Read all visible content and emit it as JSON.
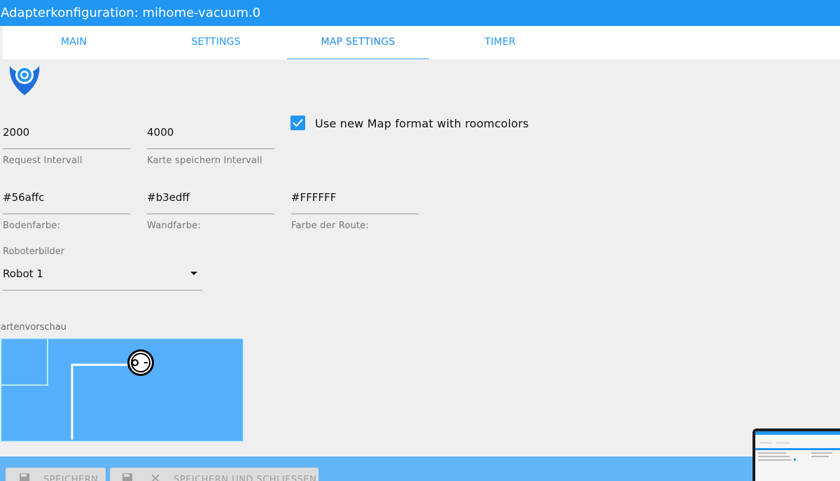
{
  "window": {
    "title": "Adapterkonfiguration: mihome-vacuum.0"
  },
  "tabs": [
    {
      "label": "MAIN"
    },
    {
      "label": "SETTINGS"
    },
    {
      "label": "MAP SETTINGS"
    },
    {
      "label": "TIMER"
    }
  ],
  "fields": {
    "request_interval": {
      "value": "2000",
      "label": "Request Intervall"
    },
    "map_save_interval": {
      "value": "4000",
      "label": "Karte speichern Intervall"
    },
    "floor_color": {
      "value": "#56affc",
      "label": "Bodenfarbe:"
    },
    "wall_color": {
      "value": "#b3edff",
      "label": "Wandfarbe:"
    },
    "route_color": {
      "value": "#FFFFFF",
      "label": "Farbe der Route:"
    }
  },
  "checkbox": {
    "label": "Use new Map format with roomcolors",
    "checked": true
  },
  "robot_select": {
    "label": "Roboterbilder",
    "value": "Robot 1"
  },
  "preview": {
    "label": "artenvorschau"
  },
  "buttons": {
    "save": "SPEICHERN",
    "save_close": "SPEICHERN UND SCHLIESSEN"
  },
  "colors": {
    "accent": "#2196f3",
    "bottom_bar": "#64b5f6",
    "map_floor": "#56affc",
    "map_wall": "#b3edff",
    "map_route": "#FFFFFF"
  },
  "icons": {
    "logo": "mihome-vacuum-logo",
    "check": "check-icon",
    "dropdown": "arrow-drop-down-icon",
    "save": "floppy-disk-icon",
    "close": "close-icon",
    "robot": "robot-vacuum-icon"
  }
}
